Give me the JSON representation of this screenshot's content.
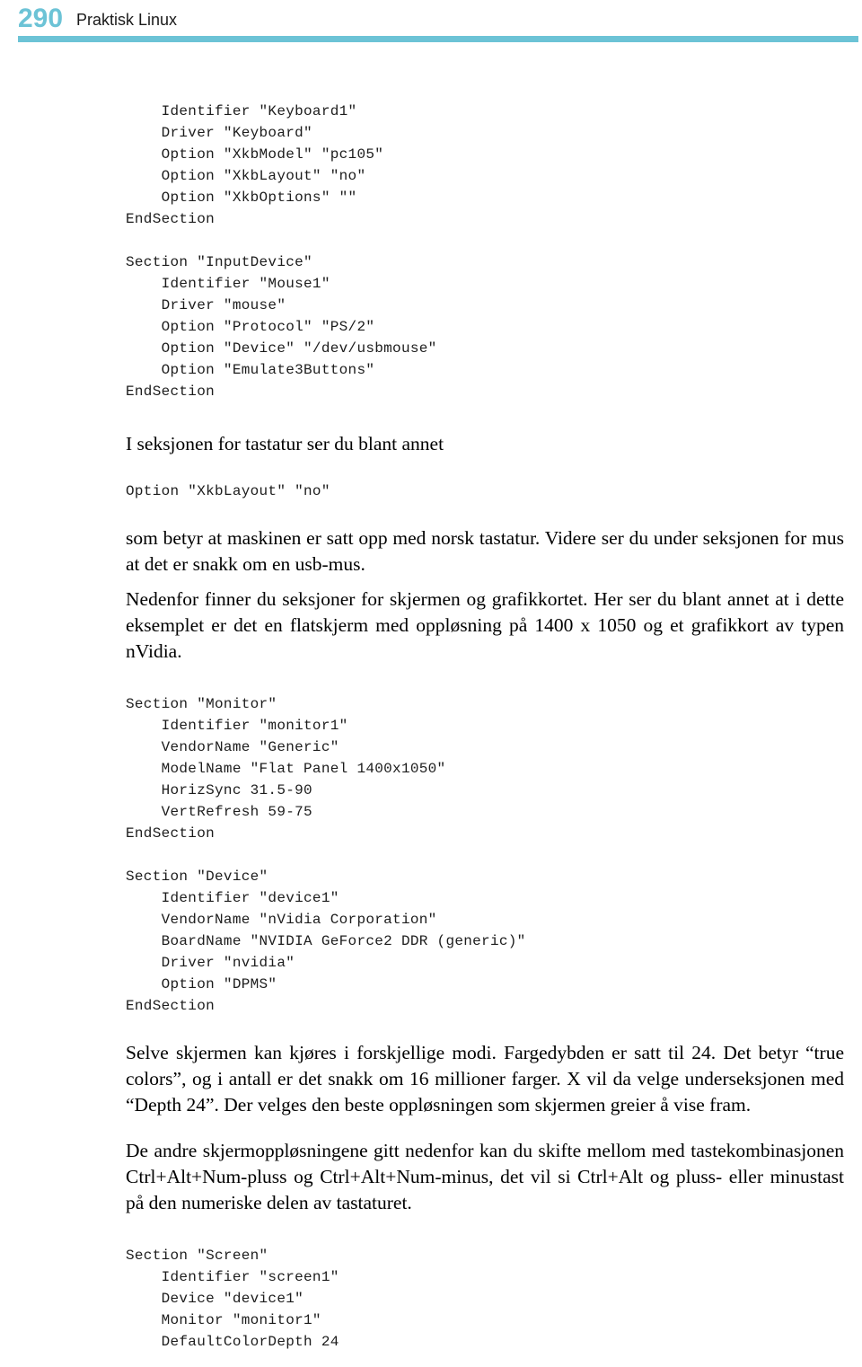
{
  "header": {
    "page_number": "290",
    "title": "Praktisk Linux",
    "rule_color": "#6cc3d6",
    "page_number_color": "#6cc3d6"
  },
  "code_block_1": {
    "lines": [
      "    Identifier \"Keyboard1\"",
      "    Driver \"Keyboard\"",
      "    Option \"XkbModel\" \"pc105\"",
      "    Option \"XkbLayout\" \"no\"",
      "    Option \"XkbOptions\" \"\"",
      "EndSection",
      "",
      "Section \"InputDevice\"",
      "    Identifier \"Mouse1\"",
      "    Driver \"mouse\"",
      "    Option \"Protocol\" \"PS/2\"",
      "    Option \"Device\" \"/dev/usbmouse\"",
      "    Option \"Emulate3Buttons\"",
      "EndSection"
    ]
  },
  "paragraph_1": "I seksjonen for tastatur ser du blant annet",
  "code_block_2": {
    "lines": [
      "Option \"XkbLayout\" \"no\""
    ]
  },
  "paragraph_2": "som betyr at maskinen er satt opp med norsk tastatur. Videre ser du under seksjonen for mus at det er snakk om en usb-mus.",
  "paragraph_3": "Nedenfor finner du seksjoner for skjermen og grafikkortet. Her ser du blant annet at i dette eksemplet er det en flatskjerm med oppløsning på 1400 x 1050 og et grafikkort av typen nVidia.",
  "code_block_3": {
    "lines": [
      "Section \"Monitor\"",
      "    Identifier \"monitor1\"",
      "    VendorName \"Generic\"",
      "    ModelName \"Flat Panel 1400x1050\"",
      "    HorizSync 31.5-90",
      "    VertRefresh 59-75",
      "EndSection",
      "",
      "Section \"Device\"",
      "    Identifier \"device1\"",
      "    VendorName \"nVidia Corporation\"",
      "    BoardName \"NVIDIA GeForce2 DDR (generic)\"",
      "    Driver \"nvidia\"",
      "    Option \"DPMS\"",
      "EndSection"
    ]
  },
  "paragraph_4": "Selve skjermen kan kjøres i forskjellige modi. Fargedybden er satt til 24. Det betyr “true colors”, og i antall er det snakk om 16 millioner farger. X vil da velge underseksjonen med “Depth 24”. Der velges den beste oppløsningen som skjermen greier å vise fram.",
  "paragraph_5": "De andre skjermoppløsningene gitt nedenfor kan du skifte mellom med tastekombinasjonen Ctrl+Alt+Num-pluss og Ctrl+Alt+Num-minus, det vil si Ctrl+Alt og pluss- eller minustast på den numeriske delen av tastaturet.",
  "code_block_4": {
    "lines": [
      "Section \"Screen\"",
      "    Identifier \"screen1\"",
      "    Device \"device1\"",
      "    Monitor \"monitor1\"",
      "    DefaultColorDepth 24"
    ]
  }
}
